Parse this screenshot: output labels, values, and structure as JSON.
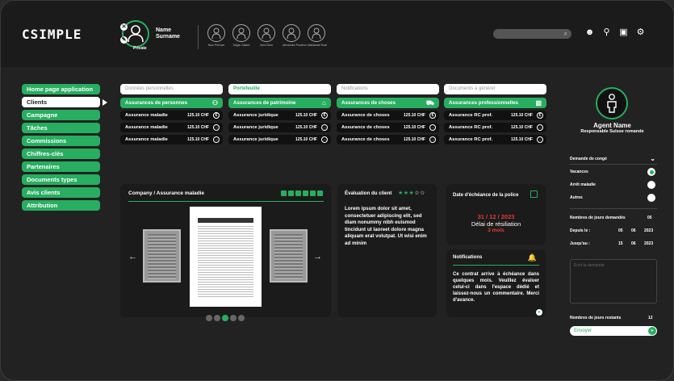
{
  "app": {
    "logo": "CSIMPLE"
  },
  "profile": {
    "first": "Name",
    "last": "Surname",
    "badge": "Private"
  },
  "contacts": [
    {
      "label": "Nom Prénom"
    },
    {
      "label": "Edgar Juliard"
    },
    {
      "label": "Nom Nom"
    },
    {
      "label": "Alexandre Prudhon"
    },
    {
      "label": "Nathanael Ruel"
    }
  ],
  "toolbar": {
    "search_icon": "search-icon"
  },
  "menu": [
    "Home page application",
    "Clients",
    "Campagne",
    "Tâches",
    "Commissions",
    "Chiffres-clés",
    "Partenaires",
    "Documents types",
    "Avis clients",
    "Attribution"
  ],
  "columns": [
    {
      "header": "Données personnelles",
      "category": "Assurances de personnes",
      "rows": [
        {
          "name": "Assurance maladie",
          "price": "125.10 CHF",
          "icon": "€"
        },
        {
          "name": "Assurance maladie",
          "price": "125.10 CHF",
          "icon": "→"
        },
        {
          "name": "Assurance maladie",
          "price": "125.10 CHF",
          "icon": "→"
        }
      ]
    },
    {
      "header": "Portefeuille",
      "category": "Assurances de patrimoine",
      "rows": [
        {
          "name": "Assurance juridique",
          "price": "125.10 CHF",
          "icon": "€"
        },
        {
          "name": "Assurance juridique",
          "price": "125.10 CHF",
          "icon": "→"
        },
        {
          "name": "Assurance juridique",
          "price": "125.10 CHF",
          "icon": "→"
        }
      ]
    },
    {
      "header": "Notifications",
      "category": "Assurances de choses",
      "rows": [
        {
          "name": "Assurance de choses",
          "price": "125.10 CHF",
          "icon": "€"
        },
        {
          "name": "Assurance de choses",
          "price": "125.10 CHF",
          "icon": "→"
        },
        {
          "name": "Assurance de choses",
          "price": "125.10 CHF",
          "icon": "→"
        }
      ]
    },
    {
      "header": "Documents à générer",
      "category": "Assurances professionnelles",
      "rows": [
        {
          "name": "Assurance RC prof.",
          "price": "125.10 CHF",
          "icon": "€"
        },
        {
          "name": "Assurance RC prof.",
          "price": "125.10 CHF",
          "icon": "→"
        },
        {
          "name": "Assurance RC prof.",
          "price": "125.10 CHF",
          "icon": "→"
        }
      ]
    }
  ],
  "viewer": {
    "breadcrumb": "Company  /  Assurance maladie"
  },
  "evaluation": {
    "title": "Évaluation du client",
    "stars_filled": "★★★",
    "stars_empty": "☆☆",
    "text": "Lorem ipsum dolor sit amet, consectetuer adipiscing elit, sed diam nonummy nibh euismod tincidunt ut laoreet dolore magna aliquam erat volutpat. Ut wisi enim ad minim"
  },
  "due": {
    "title": "Date d'échéance de la police",
    "date": "31  /  12  /  2023",
    "label": "Délai de résiliation",
    "delay": "3 mois"
  },
  "notifications": {
    "title": "Notifications",
    "text": "Ce contrat arrive à échéance dans quelques mois. Veuillez évaluer celui-ci dans l'espace dédié et laissez-nous un commentaire. Merci d'avance."
  },
  "agent": {
    "name": "Agent Name",
    "role": "Responsable Suisse romande"
  },
  "leave": {
    "title": "Demande de congé",
    "options": [
      {
        "label": "Vacances",
        "selected": true
      },
      {
        "label": "Arrêt maladie",
        "selected": false
      },
      {
        "label": "Autres",
        "selected": false
      }
    ],
    "days_label": "Nombres de jours demandés",
    "days": "05",
    "from_label": "Depuis le :",
    "from_d": "05",
    "from_m": "06",
    "from_y": "2023",
    "to_label": "Jusqu'au :",
    "to_d": "15",
    "to_m": "06",
    "to_y": "2023",
    "comment_placeholder": "Ecrit ta demande",
    "remaining_label": "Nombres de jours restants",
    "remaining": "12",
    "send": "Envoyer"
  }
}
